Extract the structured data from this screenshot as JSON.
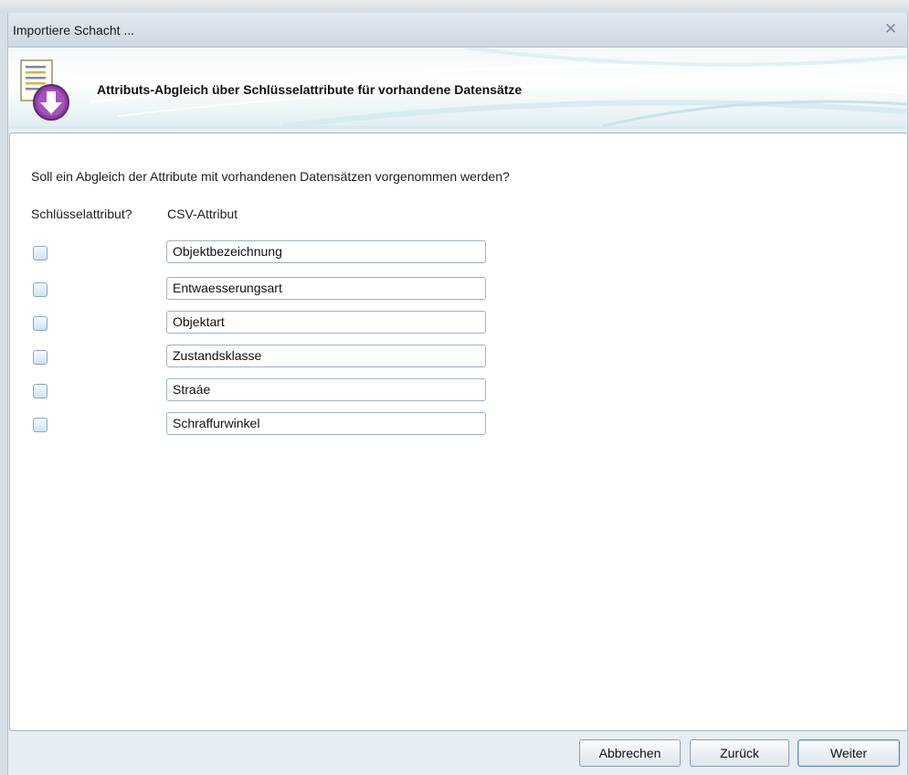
{
  "window": {
    "title": "Importiere Schacht ..."
  },
  "banner": {
    "title": "Attributs-Abgleich über Schlüsselattribute für vorhandene Datensätze"
  },
  "form": {
    "question": "Soll ein Abgleich der Attribute mit vorhandenen Datensätzen vorgenommen werden?",
    "col_key": "Schlüsselattribut?",
    "col_csv": "CSV-Attribut",
    "rows": [
      {
        "value": "Objektbezeichnung",
        "checked": false
      },
      {
        "value": "Entwaesserungsart",
        "checked": false
      },
      {
        "value": "Objektart",
        "checked": false
      },
      {
        "value": "Zustandsklasse",
        "checked": false
      },
      {
        "value": "Straáe",
        "checked": false
      },
      {
        "value": "Schraffurwinkel",
        "checked": false
      }
    ]
  },
  "buttons": {
    "cancel": "Abbrechen",
    "back": "Zurück",
    "next": "Weiter"
  },
  "colors": {
    "accent": "#5c8db8",
    "window_bg": "#e6edf3",
    "panel_bg": "#ffffff"
  },
  "icons": {
    "banner": "document-download-icon",
    "close": "close-icon"
  }
}
